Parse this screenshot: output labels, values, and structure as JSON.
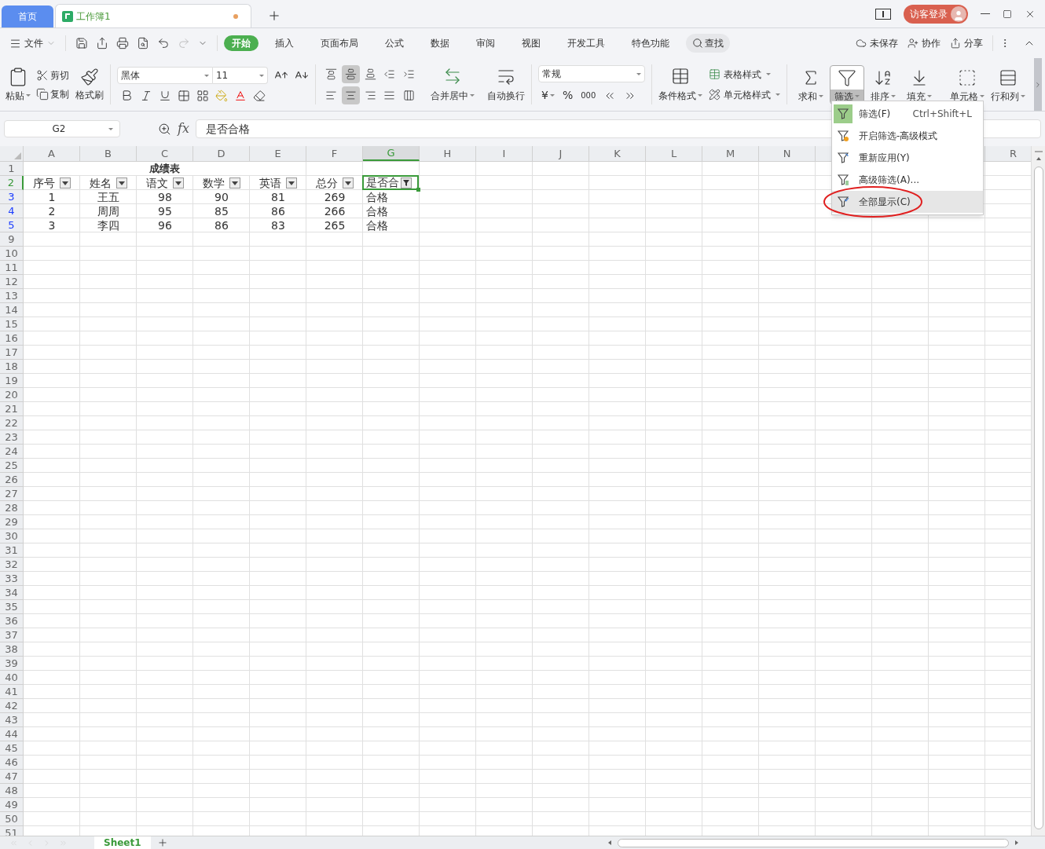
{
  "tabs": [
    {
      "label": "首页",
      "kind": "home",
      "selected": false
    },
    {
      "label": "工作簿1",
      "kind": "doc",
      "selected": true,
      "unsaved": true
    }
  ],
  "title_bar": {
    "login": "访客登录"
  },
  "menu": {
    "file": "文件",
    "tabs": [
      {
        "label": "开始",
        "selected": true
      },
      {
        "label": "插入",
        "selected": false
      },
      {
        "label": "页面布局",
        "selected": false
      },
      {
        "label": "公式",
        "selected": false
      },
      {
        "label": "数据",
        "selected": false
      },
      {
        "label": "审阅",
        "selected": false
      },
      {
        "label": "视图",
        "selected": false
      },
      {
        "label": "开发工具",
        "selected": false
      },
      {
        "label": "特色功能",
        "selected": false
      }
    ],
    "search": "查找",
    "actions": [
      "未保存",
      "协作",
      "分享"
    ]
  },
  "ribbon": {
    "paste": "粘贴",
    "cut": "剪切",
    "copy": "复制",
    "format_painter": "格式刷",
    "font": "黑体",
    "font_size": "11",
    "align_buttons": [
      {
        "kind": "top",
        "selected": false
      },
      {
        "kind": "middle",
        "selected": true
      },
      {
        "kind": "bottom",
        "selected": false
      },
      {
        "kind": "outdent",
        "selected": false
      },
      {
        "kind": "indent",
        "selected": false
      },
      {
        "kind": "left",
        "selected": false
      },
      {
        "kind": "center",
        "selected": true
      },
      {
        "kind": "right",
        "selected": false
      },
      {
        "kind": "justify",
        "selected": false
      },
      {
        "kind": "distributed",
        "selected": false
      }
    ],
    "merge": "合并居中",
    "wrap": "自动换行",
    "number_format": "常规",
    "currency": "¥",
    "percent": "%",
    "thousands": "000",
    "conditional": "条件格式",
    "table_style": "表格样式",
    "cell_style": "单元格样式",
    "tools": [
      {
        "label": "求和",
        "kind": "sum",
        "selected": false
      },
      {
        "label": "筛选",
        "kind": "filter",
        "selected": true
      },
      {
        "label": "排序",
        "kind": "sort",
        "selected": false
      },
      {
        "label": "填充",
        "kind": "fill",
        "selected": false
      },
      {
        "label": "单元格",
        "kind": "cell",
        "selected": false
      },
      {
        "label": "行和列",
        "kind": "rowcol",
        "selected": false
      }
    ]
  },
  "formula_bar": {
    "name_box": "G2",
    "fx": "fx",
    "formula": "是否合格"
  },
  "sheet": {
    "columns": [
      {
        "label": "A",
        "selected": false
      },
      {
        "label": "B",
        "selected": false
      },
      {
        "label": "C",
        "selected": false
      },
      {
        "label": "D",
        "selected": false
      },
      {
        "label": "E",
        "selected": false
      },
      {
        "label": "F",
        "selected": false
      },
      {
        "label": "G",
        "selected": true
      },
      {
        "label": "H",
        "selected": false
      },
      {
        "label": "I",
        "selected": false
      },
      {
        "label": "J",
        "selected": false
      },
      {
        "label": "K",
        "selected": false
      },
      {
        "label": "L",
        "selected": false
      },
      {
        "label": "M",
        "selected": false
      },
      {
        "label": "N",
        "selected": false
      }
    ],
    "last_column": "R",
    "title_row": {
      "header": "1",
      "title": "成绩表"
    },
    "header_row": {
      "header": "2",
      "selected": true,
      "cells": [
        {
          "text": "序号",
          "filter_active": false
        },
        {
          "text": "姓名",
          "filter_active": false
        },
        {
          "text": "语文",
          "filter_active": false
        },
        {
          "text": "数学",
          "filter_active": false
        },
        {
          "text": "英语",
          "filter_active": false
        },
        {
          "text": "总分",
          "filter_active": false
        },
        {
          "text": "是否合",
          "filter_active": true
        }
      ]
    },
    "data_rows": [
      {
        "header": "3",
        "filtered": true,
        "cells": [
          "1",
          "王五",
          "98",
          "90",
          "81",
          "269",
          "合格"
        ]
      },
      {
        "header": "4",
        "filtered": true,
        "cells": [
          "2",
          "周周",
          "95",
          "85",
          "86",
          "266",
          "合格"
        ]
      },
      {
        "header": "5",
        "filtered": true,
        "cells": [
          "3",
          "李四",
          "96",
          "86",
          "83",
          "265",
          "合格"
        ]
      }
    ],
    "empty_rows": [
      "9",
      "10",
      "11",
      "12",
      "13",
      "14",
      "15",
      "16",
      "17",
      "18",
      "19",
      "20",
      "21",
      "22",
      "23",
      "24",
      "25",
      "26",
      "27",
      "28",
      "29",
      "30",
      "31",
      "32",
      "33",
      "34",
      "35",
      "36",
      "37",
      "38",
      "39",
      "40",
      "41",
      "42",
      "43",
      "44",
      "45",
      "46",
      "47",
      "48",
      "49",
      "50",
      "51"
    ],
    "sheet_tabs": [
      {
        "label": "Sheet1",
        "selected": true
      }
    ]
  },
  "filter_menu": {
    "items": [
      {
        "label": "筛选(F)",
        "kind": "filter",
        "shortcut": "Ctrl+Shift+L",
        "active": true,
        "hovered": false,
        "circled": false
      },
      {
        "label": "开启筛选-高级模式",
        "kind": "advanced_mode",
        "active": false,
        "hovered": false,
        "circled": false
      },
      {
        "label": "重新应用(Y)",
        "kind": "reapply",
        "active": false,
        "hovered": false,
        "circled": false
      },
      {
        "label": "高级筛选(A)...",
        "kind": "advanced",
        "active": false,
        "hovered": false,
        "circled": false
      },
      {
        "label": "全部显示(C)",
        "kind": "show_all",
        "active": false,
        "hovered": true,
        "circled": true
      }
    ]
  }
}
